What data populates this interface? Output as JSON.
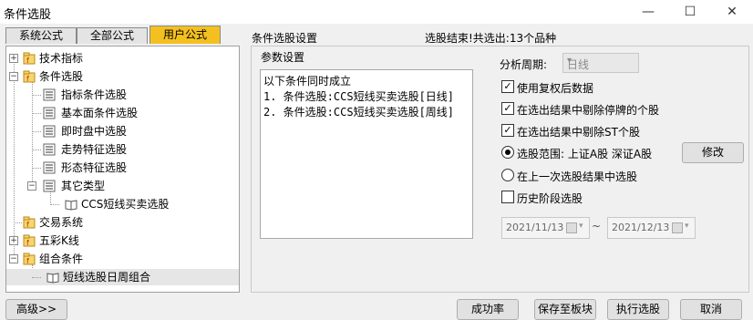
{
  "window": {
    "title": "条件选股",
    "minimize": "—",
    "maximize": "☐",
    "close": "✕"
  },
  "tabs": [
    "系统公式",
    "全部公式",
    "用户公式"
  ],
  "section_label": "条件选股设置",
  "status": "选股结束!共选出:13个品种",
  "tree": [
    {
      "label": "技术指标",
      "expander": "+",
      "icon": "formula-folder-icon"
    },
    {
      "label": "条件选股",
      "expander": "−",
      "icon": "formula-folder-icon"
    },
    {
      "label": "指标条件选股",
      "icon": "list-icon"
    },
    {
      "label": "基本面条件选股",
      "icon": "list-icon"
    },
    {
      "label": "即时盘中选股",
      "icon": "list-icon"
    },
    {
      "label": "走势特征选股",
      "icon": "list-icon"
    },
    {
      "label": "形态特征选股",
      "icon": "list-icon"
    },
    {
      "label": "其它类型",
      "expander": "−",
      "icon": "list-icon"
    },
    {
      "label": "CCS短线买卖选股",
      "icon": "book-icon"
    },
    {
      "label": "交易系统",
      "icon": "formula-folder-icon"
    },
    {
      "label": "五彩K线",
      "expander": "+",
      "icon": "formula-folder-icon"
    },
    {
      "label": "组合条件",
      "expander": "−",
      "icon": "formula-folder-icon"
    },
    {
      "label": "短线选股日周组合",
      "icon": "book-icon"
    }
  ],
  "params": {
    "label": "参数设置",
    "lines": [
      "以下条件同时成立",
      "1.  条件选股:CCS短线买卖选股[日线]",
      "2.  条件选股:CCS短线买卖选股[周线]"
    ]
  },
  "period": {
    "label": "分析周期:",
    "value": "日线"
  },
  "options": {
    "adjusted": {
      "label": "使用复权后数据",
      "checked": true
    },
    "exclude_suspended": {
      "label": "在选出结果中剔除停牌的个股",
      "checked": true
    },
    "exclude_st": {
      "label": "在选出结果中剔除ST个股",
      "checked": true
    },
    "range": {
      "label": "选股范围: 上证A股 深证A股",
      "selected": true
    },
    "last_result": {
      "label": "在上一次选股结果中选股",
      "selected": false
    },
    "history": {
      "label": "历史阶段选股",
      "checked": false
    }
  },
  "buttons": {
    "modify": "修改",
    "advanced": "高级>>",
    "success_rate": "成功率",
    "save_block": "保存至板块",
    "execute": "执行选股",
    "cancel": "取消"
  },
  "dates": {
    "from": "2021/11/13",
    "to": "2021/12/13",
    "separator": "~"
  }
}
